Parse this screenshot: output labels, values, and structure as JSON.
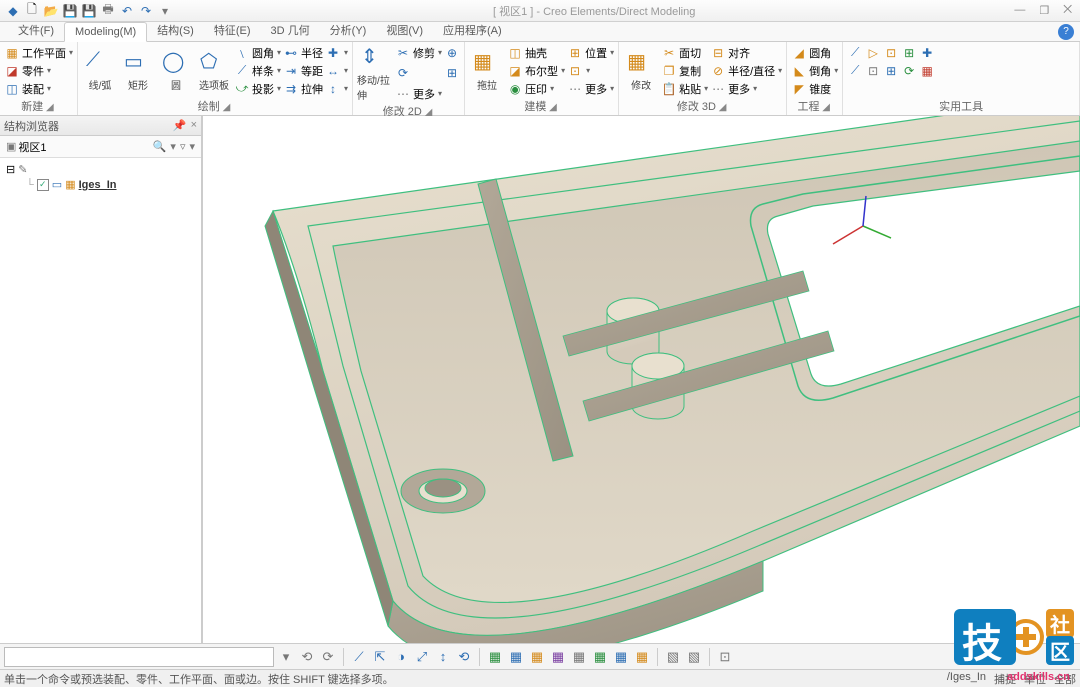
{
  "app": {
    "title_context": "[ 视区1 ]",
    "title_app": "Creo Elements/Direct Modeling"
  },
  "qat": [
    "new",
    "open",
    "save",
    "saveall",
    "print",
    "undo",
    "redo"
  ],
  "win_ctrl": {
    "min": "—",
    "max": "❐",
    "close": "⨉"
  },
  "menu": {
    "tabs": [
      "文件(F)",
      "Modeling(M)",
      "结构(S)",
      "特征(E)",
      "3D 几何",
      "分析(Y)",
      "视图(V)",
      "应用程序(A)"
    ],
    "active_index": 1
  },
  "ribbon": {
    "groups": [
      {
        "name": "新建",
        "col_items": [
          {
            "icon": "▦",
            "label": "工作平面",
            "dd": true,
            "ic": "ic-orange"
          },
          {
            "icon": "◪",
            "label": "零件",
            "dd": true,
            "ic": "ic-red"
          },
          {
            "icon": "◫",
            "label": "装配",
            "dd": true,
            "ic": "ic-blue"
          }
        ]
      },
      {
        "name": "绘制",
        "bigs": [
          {
            "icon": "◯",
            "label": "线/弧",
            "dd": true,
            "ic": "ic-blue"
          },
          {
            "icon": "▭",
            "label": "矩形",
            "dd": true,
            "ic": "ic-blue"
          },
          {
            "icon": "◯",
            "label": "圆",
            "dd": true,
            "ic": "ic-blue"
          },
          {
            "icon": "⬠",
            "label": "选项板",
            "dd": false,
            "ic": "ic-blue"
          }
        ],
        "col_items": [
          {
            "icon": "﹨",
            "label": "圆角",
            "dd": true,
            "ic": "ic-blue"
          },
          {
            "icon": "⟋",
            "label": "样条",
            "dd": true,
            "ic": "ic-blue"
          },
          {
            "icon": "⤻",
            "label": "投影",
            "dd": true,
            "ic": "ic-green"
          }
        ],
        "col_items2": [
          {
            "icon": "⊷",
            "label": "半径",
            "dd": false,
            "ic": "ic-blue"
          },
          {
            "icon": "⇥",
            "label": "等距",
            "dd": false,
            "ic": "ic-blue"
          },
          {
            "icon": "⇉",
            "label": "拉伸",
            "dd": false,
            "ic": "ic-blue"
          }
        ],
        "col_items3": [
          {
            "icon": "✚",
            "label": "",
            "dd": true,
            "ic": "ic-blue"
          },
          {
            "icon": "↔",
            "label": "",
            "dd": true,
            "ic": "ic-blue"
          },
          {
            "icon": "↕",
            "label": "",
            "dd": true,
            "ic": "ic-blue"
          }
        ]
      },
      {
        "name": "修改 2D",
        "bigs": [
          {
            "icon": "↕",
            "label": "移动/拉伸",
            "dd": true,
            "ic": "ic-blue"
          }
        ],
        "col_items": [
          {
            "icon": "✂",
            "label": "修剪",
            "dd": true,
            "ic": "ic-blue"
          },
          {
            "icon": "⟳",
            "label": "",
            "dd": false,
            "ic": "ic-blue"
          },
          {
            "icon": "⋯",
            "label": "更多",
            "dd": true,
            "ic": "ic-gray"
          }
        ],
        "col_items2": [
          {
            "icon": "⊕",
            "label": "",
            "dd": false,
            "ic": "ic-blue"
          },
          {
            "icon": "⊞",
            "label": "",
            "dd": false,
            "ic": "ic-blue"
          },
          {
            "icon": "",
            "label": "",
            "dd": false
          }
        ]
      },
      {
        "name": "建模",
        "bigs": [
          {
            "icon": "▦",
            "label": "拖拉",
            "dd": true,
            "ic": "ic-orange"
          }
        ],
        "col_items": [
          {
            "icon": "◫",
            "label": "抽壳",
            "dd": false,
            "ic": "ic-orange"
          },
          {
            "icon": "◪",
            "label": "布尔型",
            "dd": true,
            "ic": "ic-orange"
          },
          {
            "icon": "◉",
            "label": "压印",
            "dd": true,
            "ic": "ic-green"
          }
        ],
        "col_items2": [
          {
            "icon": "⊞",
            "label": "",
            "dd": true,
            "ic": "ic-orange"
          },
          {
            "icon": "⊡",
            "label": "",
            "dd": true,
            "ic": "ic-orange"
          },
          {
            "icon": "⋯",
            "label": "更多",
            "dd": true,
            "ic": "ic-gray"
          }
        ]
      },
      {
        "name": "修改 3D",
        "bigs": [
          {
            "icon": "▦",
            "label": "修改",
            "dd": true,
            "ic": "ic-orange"
          }
        ],
        "col_items": [
          {
            "icon": "✂",
            "label": "面切",
            "dd": false,
            "ic": "ic-orange"
          },
          {
            "icon": "❐",
            "label": "复制",
            "dd": false,
            "ic": "ic-orange"
          },
          {
            "icon": "📋",
            "label": "粘贴",
            "dd": true,
            "ic": "ic-orange"
          }
        ],
        "col_items2": [
          {
            "icon": "⊟",
            "label": "对齐",
            "dd": false,
            "ic": "ic-orange"
          },
          {
            "icon": "⊘",
            "label": "半径/直径",
            "dd": true,
            "ic": "ic-orange"
          },
          {
            "icon": "⋯",
            "label": "更多",
            "dd": true,
            "ic": "ic-gray"
          }
        ],
        "dd_icon": true
      },
      {
        "name": "工程",
        "col_items": [
          {
            "icon": "◢",
            "label": "圆角",
            "dd": false,
            "ic": "ic-orange"
          },
          {
            "icon": "◣",
            "label": "倒角",
            "dd": true,
            "ic": "ic-orange"
          },
          {
            "icon": "◤",
            "label": "锥度",
            "dd": false,
            "ic": "ic-orange"
          }
        ]
      },
      {
        "name": "实用工具",
        "row1": [
          {
            "icon": "⟋",
            "ic": "ic-blue"
          },
          {
            "icon": "▷",
            "ic": "ic-orange"
          },
          {
            "icon": "⊡",
            "ic": "ic-orange"
          },
          {
            "icon": "⊞",
            "ic": "ic-green"
          },
          {
            "icon": "✚",
            "ic": "ic-blue"
          }
        ],
        "row2": [
          {
            "icon": "⟋",
            "ic": "ic-blue"
          },
          {
            "icon": "⊡",
            "ic": "ic-gray"
          },
          {
            "icon": "⊞",
            "ic": "ic-blue"
          },
          {
            "icon": "⟳",
            "ic": "ic-green"
          },
          {
            "icon": "▦",
            "ic": "ic-red"
          }
        ]
      }
    ]
  },
  "panel": {
    "title": "结构浏览器",
    "pin": "📌",
    "close": "×",
    "sub_label": "视区1",
    "sub_icons": [
      "🔍",
      "▾",
      "",
      "▿",
      ""
    ],
    "tree_root_toggle": "⊟",
    "tree_root_icon": "✎",
    "tree_child_chk": "✓",
    "tree_child_icons": [
      "▭",
      "▦"
    ],
    "tree_child_label": "Iges_In"
  },
  "bottom_toolbar": {
    "nav": [
      "⟲",
      "⟳"
    ],
    "group1": [
      "⟋",
      "⇱",
      "◑",
      "⤢",
      "↕",
      "⟲"
    ],
    "group2": [
      "▦",
      "▦",
      "▦",
      "▦",
      "▦",
      "▦",
      "▦",
      "▦"
    ],
    "group3": [
      "▧",
      "▧"
    ],
    "group4": [
      "⊡"
    ]
  },
  "statusbar": {
    "hint": "单击一个命令或预选装配、零件、工作平面、面或边。按住 SHIFT 键选择多项。",
    "right": [
      "/Iges_In",
      "捕捉",
      "单位",
      "全部"
    ]
  },
  "watermark": {
    "url": "addskills.cn",
    "txt_a": "社",
    "txt_b": "区"
  }
}
